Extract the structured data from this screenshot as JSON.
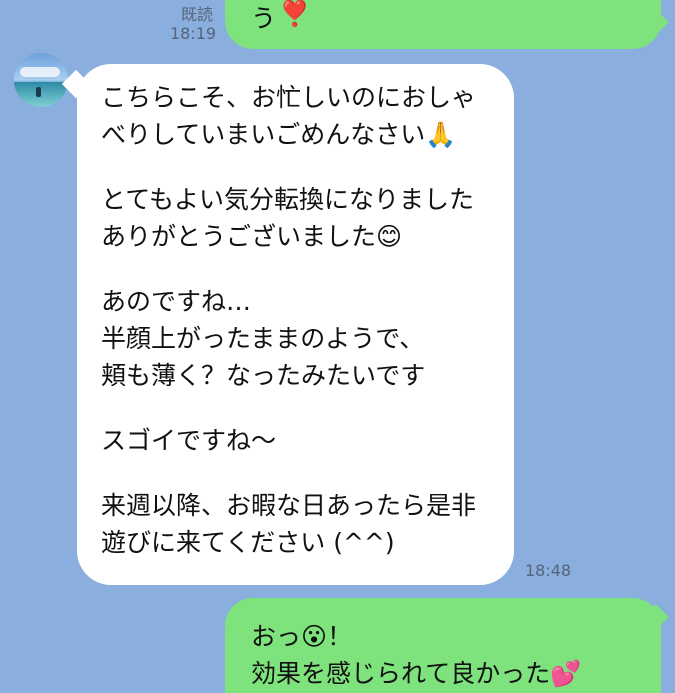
{
  "messages": {
    "previous_out": {
      "text": "う",
      "emoji": "❣️",
      "read": "既読",
      "time": "18:19"
    },
    "incoming": {
      "lines": [
        "こちらこそ、お忙しいのにおしゃ",
        "べりしていまいごめんなさい",
        "",
        "とてもよい気分転換になりました",
        "ありがとうございました",
        "",
        "あのですね…",
        "半顔上がったままのようで、",
        "頬も薄く？なったみたいです",
        "",
        "スゴイですね〜",
        "",
        "来週以降、お暇な日あったら是非",
        "遊びに来てください (^^)"
      ],
      "emoji_line2": "🙏",
      "emoji_line5": "😊",
      "time": "18:48"
    },
    "current_out": {
      "line1": "おっ",
      "line1_emoji": "😮",
      "line1_suffix": "！",
      "line2": "効果を感じられて良かった",
      "line2_emoji": "💕"
    }
  },
  "colors": {
    "background": "#8aaedd",
    "outgoing_bubble": "#7ee27d",
    "incoming_bubble": "#ffffff",
    "timestamp": "#55657c"
  }
}
